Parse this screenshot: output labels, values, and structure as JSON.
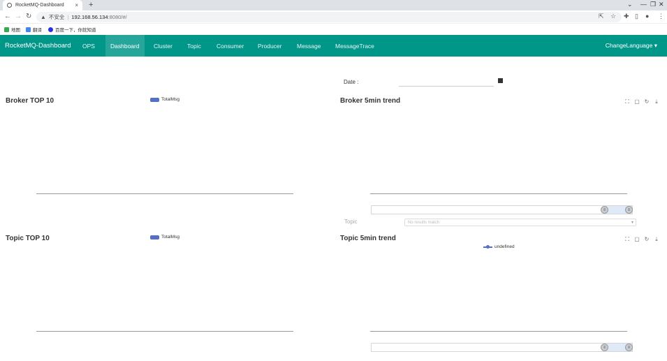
{
  "browser": {
    "tab_title": "RocketMQ-Dashboard",
    "tab_close": "×",
    "new_tab": "+",
    "window_controls": [
      "⌄",
      "—",
      "❐",
      "✕"
    ],
    "address": {
      "insecure_label": "不安全",
      "host": "192.168.56.134",
      "path": ":8080/#/"
    },
    "bookmarks": [
      {
        "label": "地图",
        "color": "#34a853"
      },
      {
        "label": "翻译",
        "color": "#4285f4"
      },
      {
        "label": "百度一下，你就知道",
        "color": "#2932e1"
      }
    ]
  },
  "navbar": {
    "brand": "RocketMQ-Dashboard",
    "items": [
      {
        "label": "OPS",
        "active": false
      },
      {
        "label": "Dashboard",
        "active": true
      },
      {
        "label": "Cluster",
        "active": false
      },
      {
        "label": "Topic",
        "active": false
      },
      {
        "label": "Consumer",
        "active": false
      },
      {
        "label": "Producer",
        "active": false
      },
      {
        "label": "Message",
        "active": false
      },
      {
        "label": "MessageTrace",
        "active": false
      }
    ],
    "language": "ChangeLanguage ▾",
    "color": "#009688"
  },
  "dashboard": {
    "date_label": "Date :",
    "broker_top10": {
      "title": "Broker TOP 10",
      "legend": "TotalMsg"
    },
    "broker_trend": {
      "title": "Broker 5min trend"
    },
    "topic_top10": {
      "title": "Topic TOP 10",
      "legend": "TotalMsg"
    },
    "topic_trend": {
      "title": "Topic 5min trend",
      "legend": "undefined"
    },
    "topic_label": "Topic",
    "topic_select_placeholder": "No results match",
    "series_color": "#5470c6"
  }
}
